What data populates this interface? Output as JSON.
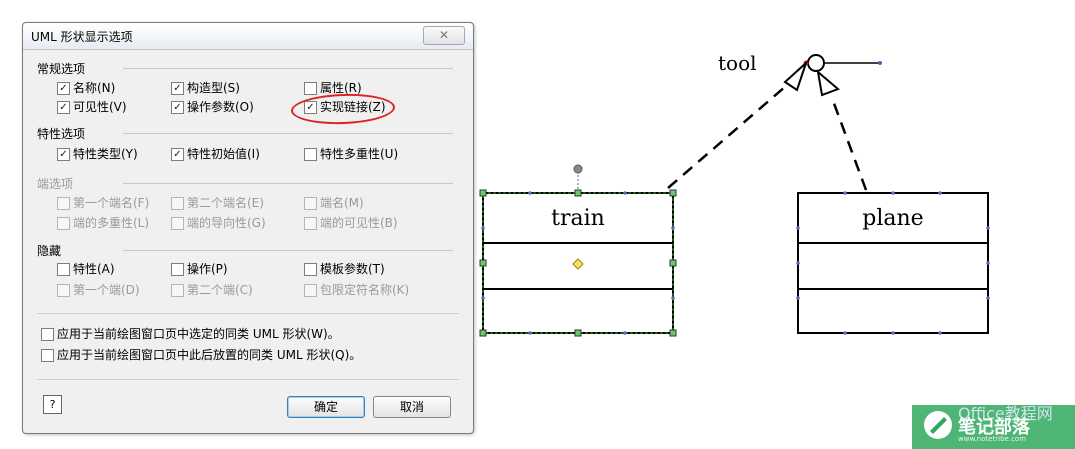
{
  "dialog": {
    "title": "UML 形状显示选项",
    "close_icon": "close-icon"
  },
  "sections": {
    "general": "常规选项",
    "properties": "特性选项",
    "ends": "端选项",
    "hide": "隐藏"
  },
  "checkboxes": {
    "name": {
      "label": "名称(N)",
      "checked": true
    },
    "stereotype": {
      "label": "构造型(S)",
      "checked": true
    },
    "attributes": {
      "label": "属性(R)",
      "checked": false
    },
    "visibility": {
      "label": "可见性(V)",
      "checked": true
    },
    "op_params": {
      "label": "操作参数(O)",
      "checked": true
    },
    "realization": {
      "label": "实现链接(Z)",
      "checked": true
    },
    "prop_type": {
      "label": "特性类型(Y)",
      "checked": true
    },
    "prop_init": {
      "label": "特性初始值(I)",
      "checked": true
    },
    "prop_mult": {
      "label": "特性多重性(U)",
      "checked": false
    },
    "end1_name": {
      "label": "第一个端名(F)",
      "checked": false
    },
    "end2_name": {
      "label": "第二个端名(E)",
      "checked": false
    },
    "end_name": {
      "label": "端名(M)",
      "checked": false
    },
    "end_mult": {
      "label": "端的多重性(L)",
      "checked": false
    },
    "end_nav": {
      "label": "端的导向性(G)",
      "checked": false
    },
    "end_vis": {
      "label": "端的可见性(B)",
      "checked": false
    },
    "hide_prop": {
      "label": "特性(A)",
      "checked": false
    },
    "hide_op": {
      "label": "操作(P)",
      "checked": false
    },
    "hide_tmpl": {
      "label": "模板参数(T)",
      "checked": false
    },
    "hide_end1": {
      "label": "第一个端(D)",
      "checked": false
    },
    "hide_end2": {
      "label": "第二个端(C)",
      "checked": false
    },
    "hide_qual": {
      "label": "包限定符名称(K)",
      "checked": false
    },
    "apply_selected": {
      "label": "应用于当前绘图窗口页中选定的同类 UML 形状(W)。",
      "checked": false
    },
    "apply_future": {
      "label": "应用于当前绘图窗口页中此后放置的同类 UML 形状(Q)。",
      "checked": false
    }
  },
  "buttons": {
    "help": "?",
    "ok": "确定",
    "cancel": "取消"
  },
  "diagram": {
    "interface_label": "tool",
    "class1": "train",
    "class2": "plane"
  },
  "watermark": {
    "office": "Office教程网",
    "name": "笔记部落",
    "url": "www.notetribe.com"
  }
}
